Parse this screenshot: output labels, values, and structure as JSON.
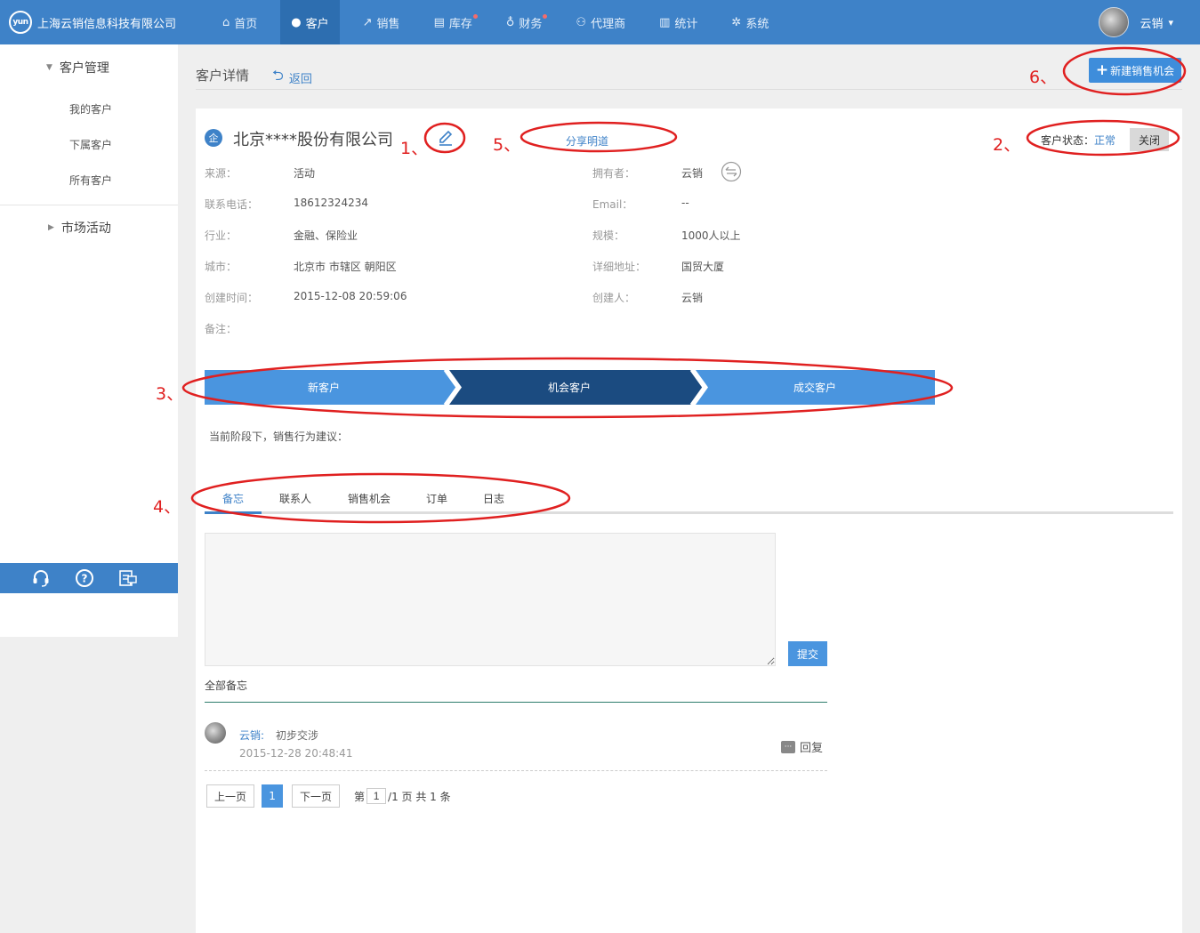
{
  "brand": {
    "logo_text": "yun",
    "company": "上海云销信息科技有限公司"
  },
  "nav": [
    {
      "label": "首页",
      "icon": "home-icon",
      "glyph": "⌂",
      "dot": false,
      "active": false
    },
    {
      "label": "客户",
      "icon": "user-icon",
      "glyph": "●",
      "dot": false,
      "active": true
    },
    {
      "label": "销售",
      "icon": "chart-icon",
      "glyph": "↗",
      "dot": false,
      "active": false
    },
    {
      "label": "库存",
      "icon": "warehouse-icon",
      "glyph": "▤",
      "dot": true,
      "active": false
    },
    {
      "label": "财务",
      "icon": "money-bag-icon",
      "glyph": "♁",
      "dot": true,
      "active": false
    },
    {
      "label": "代理商",
      "icon": "agents-icon",
      "glyph": "⚇",
      "dot": false,
      "active": false
    },
    {
      "label": "统计",
      "icon": "bar-chart-icon",
      "glyph": "▥",
      "dot": false,
      "active": false
    },
    {
      "label": "系统",
      "icon": "gear-icon",
      "glyph": "✲",
      "dot": false,
      "active": false
    }
  ],
  "user": {
    "name": "云销"
  },
  "sidebar": {
    "group1": "客户管理",
    "items": [
      "我的客户",
      "下属客户",
      "所有客户"
    ],
    "group2": "市场活动"
  },
  "header": {
    "title": "客户详情",
    "back": "返回",
    "new_button": "新建销售机会"
  },
  "customer": {
    "icon_text": "企",
    "name": "北京****股份有限公司",
    "share": "分享明道",
    "status_label": "客户状态：",
    "status_value": "正常",
    "close_button": "关闭"
  },
  "info": [
    {
      "label": "来源：",
      "value": "活动",
      "label2": "拥有者：",
      "value2": "云销"
    },
    {
      "label": "联系电话：",
      "value": "18612324234",
      "label2": "Email：",
      "value2": "--"
    },
    {
      "label": "行业：",
      "value": "金融、保险业",
      "label2": "规模：",
      "value2": "1000人以上"
    },
    {
      "label": "城市：",
      "value": "北京市 市辖区 朝阳区",
      "label2": "详细地址：",
      "value2": "国贸大厦"
    },
    {
      "label": "创建时间：",
      "value": "2015-12-08 20:59:06",
      "label2": "创建人：",
      "value2": "云销"
    },
    {
      "label": "备注：",
      "value": "",
      "label2": "",
      "value2": ""
    }
  ],
  "stages": [
    "新客户",
    "机会客户",
    "成交客户"
  ],
  "current_stage_index": 1,
  "stage_colors": {
    "normal": "#4a95df",
    "active": "#1b4b80"
  },
  "advice": "当前阶段下，销售行为建议：",
  "tabs": [
    "备忘",
    "联系人",
    "销售机会",
    "订单",
    "日志"
  ],
  "memo": {
    "submit": "提交",
    "all_label": "全部备忘",
    "entries": [
      {
        "author": "云销:",
        "text": "初步交涉",
        "time": "2015-12-28 20:48:41",
        "reply": "回复"
      }
    ]
  },
  "pager": {
    "prev": "上一页",
    "current": "1",
    "next": "下一页",
    "prefix": "第",
    "page_value": "1",
    "suffix": "/1 页 共 1 条"
  },
  "annotations": [
    "1、",
    "2、",
    "3、",
    "4、",
    "5、",
    "6、"
  ],
  "annotation_color": "#e02020"
}
